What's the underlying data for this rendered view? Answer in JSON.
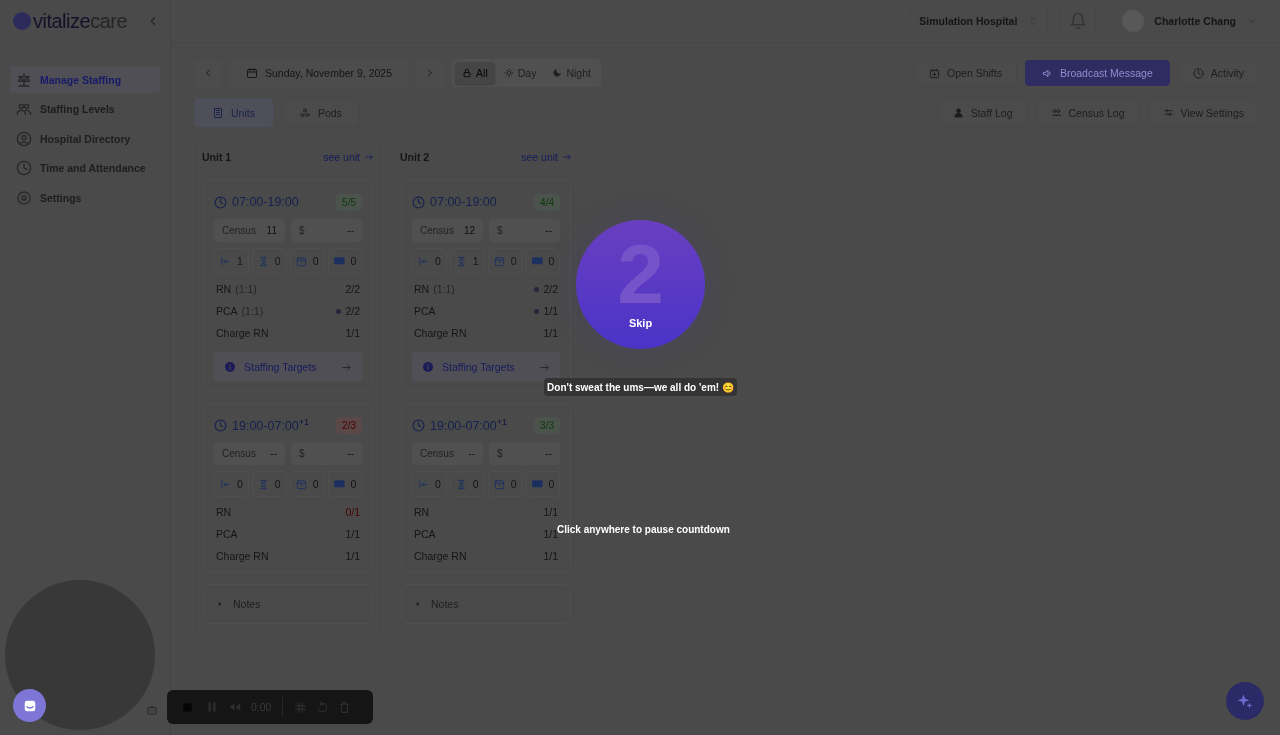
{
  "sidebar": {
    "logo": {
      "part_1": "vitalize",
      "part_2": "care"
    },
    "items": [
      {
        "label": "Manage Staffing",
        "selected": true
      },
      {
        "label": "Staffing Levels",
        "selected": false
      },
      {
        "label": "Hospital Directory",
        "selected": false
      },
      {
        "label": "Time and Attendance",
        "selected": false
      },
      {
        "label": "Settings",
        "selected": false
      }
    ]
  },
  "header": {
    "hospital": "Simulation Hospital",
    "user": "Charlotte Chang"
  },
  "toolbar": {
    "date": "Sunday, November 9, 2025",
    "shift_filter": [
      {
        "label": "All",
        "selected": true
      },
      {
        "label": "Day",
        "selected": false
      },
      {
        "label": "Night",
        "selected": false
      }
    ],
    "actions": [
      {
        "label": "Open Shifts",
        "kind": "default"
      },
      {
        "label": "Broadcast Message",
        "kind": "primary"
      },
      {
        "label": "Activity",
        "kind": "default"
      }
    ],
    "view_toggle": [
      {
        "label": "Units",
        "selected": true
      },
      {
        "label": "Pods",
        "selected": false
      }
    ],
    "logs": [
      {
        "label": "Staff Log"
      },
      {
        "label": "Census Log"
      },
      {
        "label": "View Settings"
      }
    ]
  },
  "units": [
    {
      "name": "Unit 1",
      "link": "see unit",
      "notes": "Notes",
      "shifts": [
        {
          "time": "07:00-19:00",
          "filled": "5/5",
          "short": false,
          "census_label": "Census",
          "census": "11",
          "budget_label": "$",
          "budget": "--",
          "counts": [
            "1",
            "0",
            "0",
            "0"
          ],
          "targets": "Staffing Targets",
          "roles": [
            {
              "name": "RN",
              "ratio": "(1:1)",
              "value": "2/2",
              "dot": false,
              "short": false
            },
            {
              "name": "PCA",
              "ratio": "(1:1)",
              "value": "2/2",
              "dot": true,
              "short": false
            },
            {
              "name": "Charge RN",
              "value": "1/1",
              "dot": false,
              "short": false
            }
          ]
        },
        {
          "time": "19:00-07:00$^{+1}$",
          "filled": "2/3",
          "short": true,
          "census_label": "Census",
          "census": "--",
          "budget_label": "$",
          "budget": "--",
          "counts": [
            "0",
            "0",
            "0",
            "0"
          ],
          "roles": [
            {
              "name": "RN",
              "value": "0/1",
              "dot": false,
              "short": true
            },
            {
              "name": "PCA",
              "value": "1/1",
              "dot": false,
              "short": false
            },
            {
              "name": "Charge RN",
              "value": "1/1",
              "dot": false,
              "short": false
            }
          ]
        }
      ]
    },
    {
      "name": "Unit 2",
      "link": "see unit",
      "notes": "Notes",
      "shifts": [
        {
          "time": "07:00-19:00",
          "filled": "4/4",
          "short": false,
          "census_label": "Census",
          "census": "12",
          "budget_label": "$",
          "budget": "--",
          "counts": [
            "0",
            "1",
            "0",
            "0"
          ],
          "targets": "Staffing Targets",
          "roles": [
            {
              "name": "RN",
              "ratio": "(1:1)",
              "value": "2/2",
              "dot": true,
              "short": false
            },
            {
              "name": "PCA",
              "value": "1/1",
              "dot": true,
              "short": false
            },
            {
              "name": "Charge RN",
              "value": "1/1",
              "dot": false,
              "short": false
            }
          ]
        },
        {
          "time": "19:00-07:00$^{+1}$",
          "filled": "3/3",
          "short": false,
          "census_label": "Census",
          "census": "--",
          "budget_label": "$",
          "budget": "--",
          "counts": [
            "0",
            "0",
            "0",
            "0"
          ],
          "roles": [
            {
              "name": "RN",
              "value": "1/1",
              "dot": false,
              "short": false
            },
            {
              "name": "PCA",
              "value": "1/1",
              "dot": false,
              "short": false
            },
            {
              "name": "Charge RN",
              "value": "1/1",
              "dot": false,
              "short": false
            }
          ]
        }
      ]
    }
  ],
  "overlay": {
    "countdown": "2",
    "skip": "Skip",
    "tip": "Don't sweat the ums—we all do 'em! 😊",
    "hint": "Click anywhere to pause countdown"
  },
  "recorder": {
    "time": "0:00"
  }
}
